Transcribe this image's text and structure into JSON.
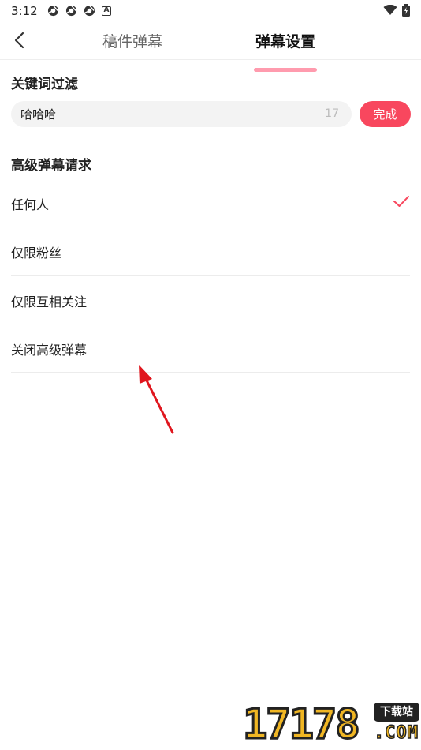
{
  "status_bar": {
    "time": "3:12",
    "notification_icons": [
      "chrome-icon",
      "chrome-icon",
      "chrome-icon",
      "a-icon"
    ],
    "notification_a_letter": "A",
    "right_icons": [
      "wifi-icon",
      "battery-icon"
    ]
  },
  "nav": {
    "back_icon": "chevron-left-icon",
    "tabs": [
      {
        "label": "稿件弹幕",
        "active": false
      },
      {
        "label": "弹幕设置",
        "active": true
      }
    ]
  },
  "keyword_filter": {
    "title": "关键词过滤",
    "input_value": "哈哈哈",
    "char_count": "17",
    "done_label": "完成"
  },
  "advanced_danmaku": {
    "title": "高级弹幕请求",
    "options": [
      {
        "label": "任何人",
        "selected": true
      },
      {
        "label": "仅限粉丝",
        "selected": false
      },
      {
        "label": "仅限互相关注",
        "selected": false
      },
      {
        "label": "关闭高级弹幕",
        "selected": false
      }
    ]
  },
  "watermark": {
    "digits": "17178",
    "badge": "下载站",
    "domain": ".COM"
  },
  "colors": {
    "accent": "#f8475e",
    "tab_underline": "#ff8aa0",
    "annotation_arrow": "#e0161e",
    "watermark_yellow": "#f0b623"
  }
}
